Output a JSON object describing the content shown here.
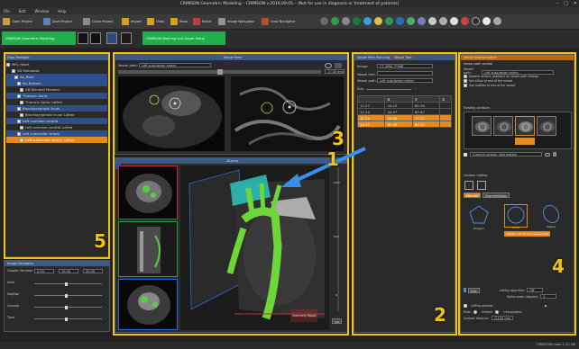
{
  "window": {
    "title": "CRIMSON Geometric Modeling – CRIMSON v.2016.09.05 – (Not for use in diagnosis or treatment of patients)",
    "controls": [
      "–",
      "□",
      "✕"
    ]
  },
  "menu": [
    "File",
    "Edit",
    "Window",
    "Help"
  ],
  "toolbar": {
    "open_project": "Open Project",
    "save_project": "Save Project",
    "close_project": "Close Project",
    "import": "Import",
    "undo": "Undo",
    "redo": "Redo",
    "reinit": "ReInit",
    "image_navigator": "Image Navigator",
    "view_navigator": "View Navigator"
  },
  "modes": {
    "geometric": "CRIMSON Geometric Modeling",
    "meshing": "CRIMSON Meshing and Solver Setup"
  },
  "data_manager": {
    "title": "Data Manager",
    "items": [
      {
        "label": "MRI_Heart",
        "state": "normal"
      },
      {
        "label": "3D Metadata",
        "state": "normal"
      },
      {
        "label": "Ao_Root",
        "state": "highlight"
      },
      {
        "label": "Ao_Bottom",
        "state": "highlight"
      },
      {
        "label": "AB Blended Meshed",
        "state": "normal"
      },
      {
        "label": "Thoracic Aorta",
        "state": "highlight"
      },
      {
        "label": "Thoracic Aorta Lofted",
        "state": "normal"
      },
      {
        "label": "Brachiocephalic trunk",
        "state": "highlight"
      },
      {
        "label": "Brachiocephalic trunk Lofted",
        "state": "normal"
      },
      {
        "label": "Left common carotid",
        "state": "highlight"
      },
      {
        "label": "Left common carotid Lofted",
        "state": "normal"
      },
      {
        "label": "Left subclavian artery",
        "state": "highlight"
      },
      {
        "label": "Left subclavian artery Lofted",
        "state": "selected"
      }
    ]
  },
  "vessel_view": {
    "title": "Vessel View",
    "vessel_path_label": "Vessel path:",
    "vessel_path_value": "Left subclavian artery",
    "zoom_value": "17.00 mm"
  },
  "display": {
    "title": "Display",
    "side_values": [
      "1000",
      "500",
      "0"
    ],
    "bottom_labels": [
      "Geometry Model",
      "MIP"
    ]
  },
  "image_settings": {
    "title": "Image Navigator",
    "rows": [
      {
        "label": "Graphic Window",
        "vals": [
          "0.00",
          "10.00",
          "20.00"
        ]
      },
      {
        "label": "Axial",
        "vals": []
      },
      {
        "label": "Sagittal",
        "vals": []
      },
      {
        "label": "Coronal",
        "vals": []
      },
      {
        "label": "Time",
        "vals": []
      }
    ]
  },
  "path_panel": {
    "tabs": [
      "Vessel Path Planning",
      "Vessel Tree"
    ],
    "image_label": "Image:",
    "image_value": "CT_MRA_***MR",
    "vessel_tree_label": "Vessel tree:",
    "vessel_path_label": "Vessel path:",
    "vessel_path_value": "Left subclavian artery",
    "size_label": "Size",
    "table_headers": [
      "",
      "X",
      "Y",
      "Z"
    ],
    "rows": [
      {
        "id": "12.27",
        "x": "44.15",
        "y": "80.16",
        "state": "normal"
      },
      {
        "id": "12.34",
        "x": "44.07",
        "y": "80.92",
        "state": "normal"
      },
      {
        "id": "11.24",
        "x": "45.69",
        "y": "77.11",
        "state": "selected"
      },
      {
        "id": "12.37",
        "x": "47.46",
        "y": "84.12",
        "state": "selected"
      }
    ]
  },
  "segmentation": {
    "title": "Vessel Segmentation",
    "section_vessel_path": "Vessel path control",
    "vessel_path_label": "Vessel path:",
    "vessel_path_value": "Left subclavian artery",
    "options": [
      "Update contour positions on vessel path change",
      "Set inflow at end of the vessel",
      "Use outflow at end of the vessel"
    ],
    "section_contours": "Existing contours",
    "current_contour_label": "Current contour information",
    "section_editing": "Contour editing",
    "tab_manual": "Manual",
    "tab_semi": "Segmentation",
    "shapes": [
      "Polygon",
      "Circle",
      "Ellipse"
    ],
    "tooltip": "Create a circle on a vessel slice",
    "lofting_algo_label": "Lofting algorithm:",
    "lofting_algo_value": "Off",
    "lofting_sep_label": "Spline order (degree):",
    "lofting_sep_value": "3",
    "lofting_preview": "Lofting preview",
    "ends_label": "Ends",
    "ends_options": [
      "Uniform",
      "Interpolation"
    ],
    "contour_dist_label": "Contour distance:",
    "contour_dist_value": "0.100 mm"
  },
  "annotations": {
    "n1": "1",
    "n2": "2",
    "n3": "3",
    "n4": "4",
    "n5": "5"
  },
  "status": {
    "right_text": "CRIMSON mem 1.22 GB"
  },
  "colors": {
    "gold": "#f2c418",
    "accent_green": "#1fb04a",
    "selection": "#e38b1e",
    "arrow": "#3a8fe8"
  }
}
